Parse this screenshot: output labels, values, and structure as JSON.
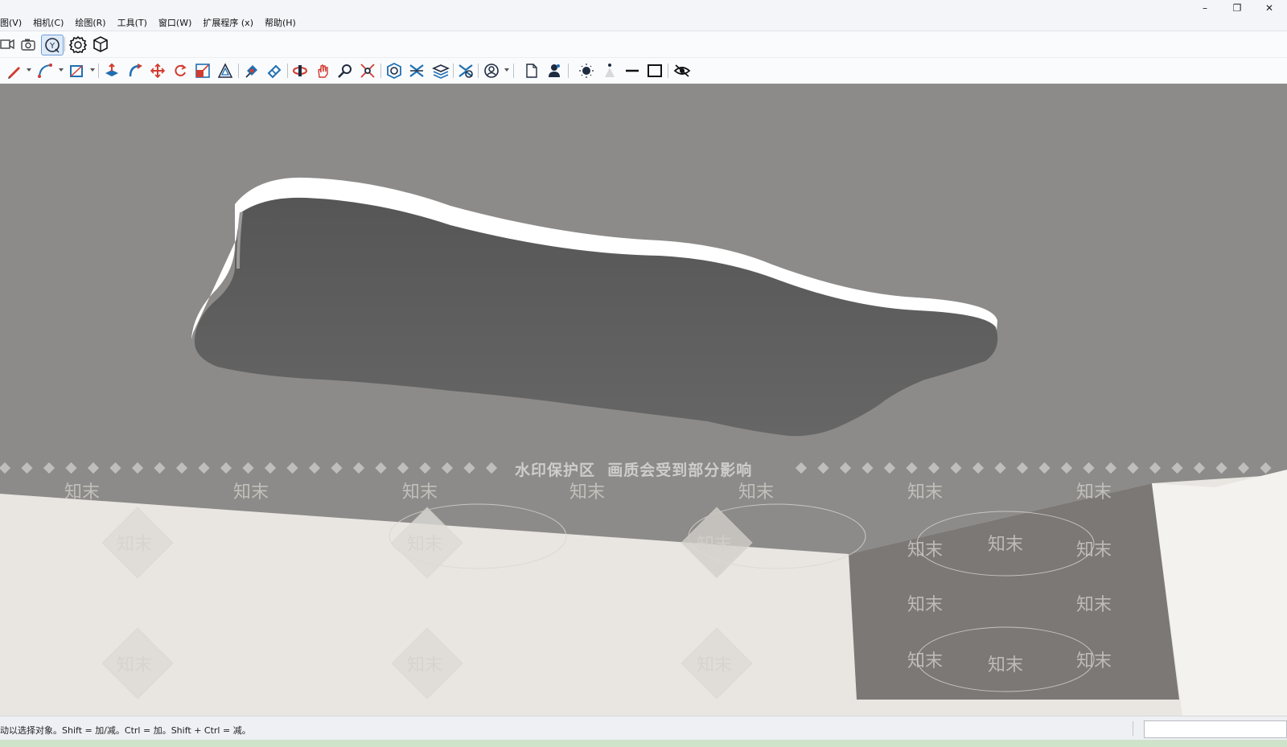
{
  "menu": {
    "items": [
      "图(V)",
      "相机(C)",
      "绘图(R)",
      "工具(T)",
      "窗口(W)",
      "扩展程序 (x)",
      "帮助(H)"
    ]
  },
  "window_controls": {
    "minimize": "–",
    "restore": "❐",
    "close": "✕"
  },
  "toolbar1": {
    "icons": [
      "camera-record-icon",
      "camera-icon",
      "section-plane-icon",
      "gear-hexagon-icon",
      "component-box-icon"
    ],
    "active": "section-plane-icon"
  },
  "toolbar2": {
    "icons": [
      "pencil-line-icon",
      "arc-icon",
      "rectangle-icon",
      "push-pull-icon",
      "follow-me-icon",
      "move-icon",
      "rotate-icon",
      "scale-icon",
      "offset-icon",
      "paint-bucket-icon",
      "eraser-icon",
      "orbit-icon",
      "pan-icon",
      "zoom-icon",
      "zoom-extents-icon",
      "solid-union-icon",
      "solid-subtract-icon",
      "layers-icon",
      "styles-icon",
      "user-circle-icon",
      "new-document-icon",
      "person-icon",
      "shadow-sun-icon",
      "fog-icon",
      "line-icon",
      "frame-icon",
      "hide-eye-icon"
    ],
    "colors": {
      "icon_red": "#d23b2f",
      "icon_blue": "#1f6fb2",
      "icon_dark": "#1e2b40"
    }
  },
  "viewport": {
    "watermark_text": "水印保护区  画质会受到部分影响",
    "watermark_brand": "知末",
    "colors": {
      "background": "#8d8b89",
      "slab_top": "#ffffff",
      "slab_bottom": "#5f5f5f",
      "floor": "#f2efec",
      "wall": "#6f6c6a"
    }
  },
  "status": {
    "text": "动以选择对象。Shift = 加/减。Ctrl = 加。Shift + Ctrl = 减。",
    "measure_value": ""
  }
}
